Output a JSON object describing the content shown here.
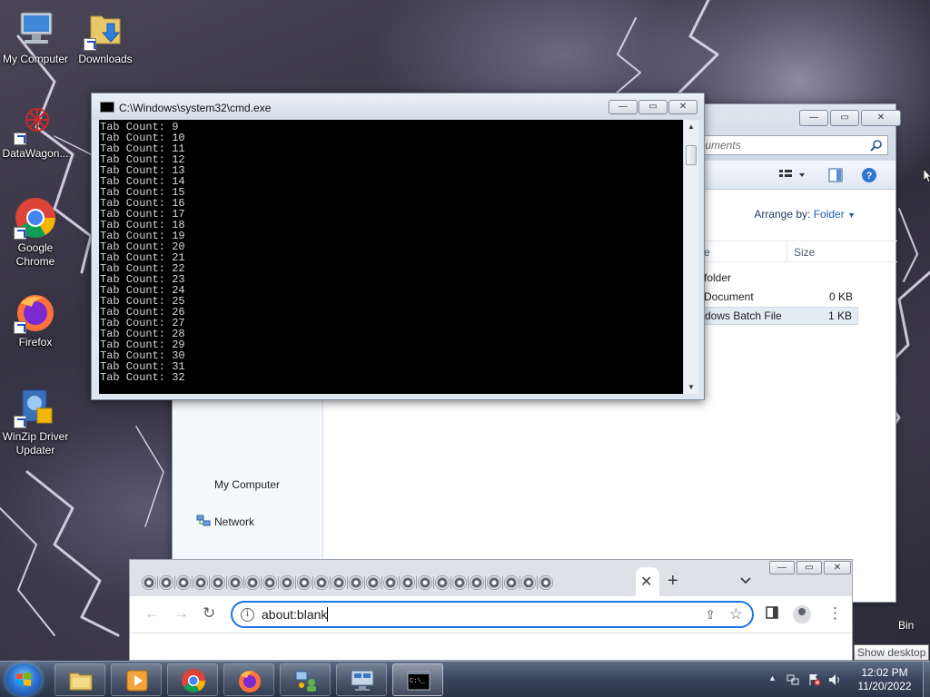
{
  "desktop": {
    "icons": [
      {
        "label": "My Computer",
        "icon": "computer-icon"
      },
      {
        "label": "Downloads",
        "icon": "folder-download-icon"
      },
      {
        "label": "DataWagon...",
        "icon": "datawagon-icon"
      },
      {
        "label": "Google Chrome",
        "icon": "chrome-icon"
      },
      {
        "label": "Firefox",
        "icon": "firefox-icon"
      },
      {
        "label": "WinZip Driver Updater",
        "icon": "winzip-driver-updater-icon"
      }
    ],
    "recycle_bin_label": "Bin",
    "show_desktop_tooltip": "Show desktop"
  },
  "cmd": {
    "title": "C:\\Windows\\system32\\cmd.exe",
    "lines": [
      "Tab Count: 9",
      "Tab Count: 10",
      "Tab Count: 11",
      "Tab Count: 12",
      "Tab Count: 13",
      "Tab Count: 14",
      "Tab Count: 15",
      "Tab Count: 16",
      "Tab Count: 17",
      "Tab Count: 18",
      "Tab Count: 19",
      "Tab Count: 20",
      "Tab Count: 21",
      "Tab Count: 22",
      "Tab Count: 23",
      "Tab Count: 24",
      "Tab Count: 25",
      "Tab Count: 26",
      "Tab Count: 27",
      "Tab Count: 28",
      "Tab Count: 29",
      "Tab Count: 30",
      "Tab Count: 31",
      "Tab Count: 32"
    ],
    "buttons": {
      "minimize": "—",
      "maximize": "▭",
      "close": "✕"
    }
  },
  "explorer": {
    "search_placeholder": "Documents",
    "arrange_label": "Arrange by:",
    "arrange_value": "Folder",
    "columns": {
      "name": "e",
      "size": "Size"
    },
    "files": [
      {
        "name": "folder",
        "size": ""
      },
      {
        "name": "Document",
        "size": "0 KB"
      },
      {
        "name": "dows Batch File",
        "size": "1 KB"
      }
    ],
    "nav": {
      "my_computer": "My Computer",
      "network": "Network"
    }
  },
  "chrome": {
    "url": "about:blank",
    "tab_count_icons": 24,
    "tab_close": "✕",
    "new_tab": "+",
    "tab_list": "⌄"
  },
  "taskbar": {
    "time": "12:02 PM",
    "date": "11/20/2022",
    "items": [
      "explorer",
      "media-player",
      "chrome",
      "firefox",
      "network-app",
      "remote-app",
      "cmd"
    ]
  }
}
